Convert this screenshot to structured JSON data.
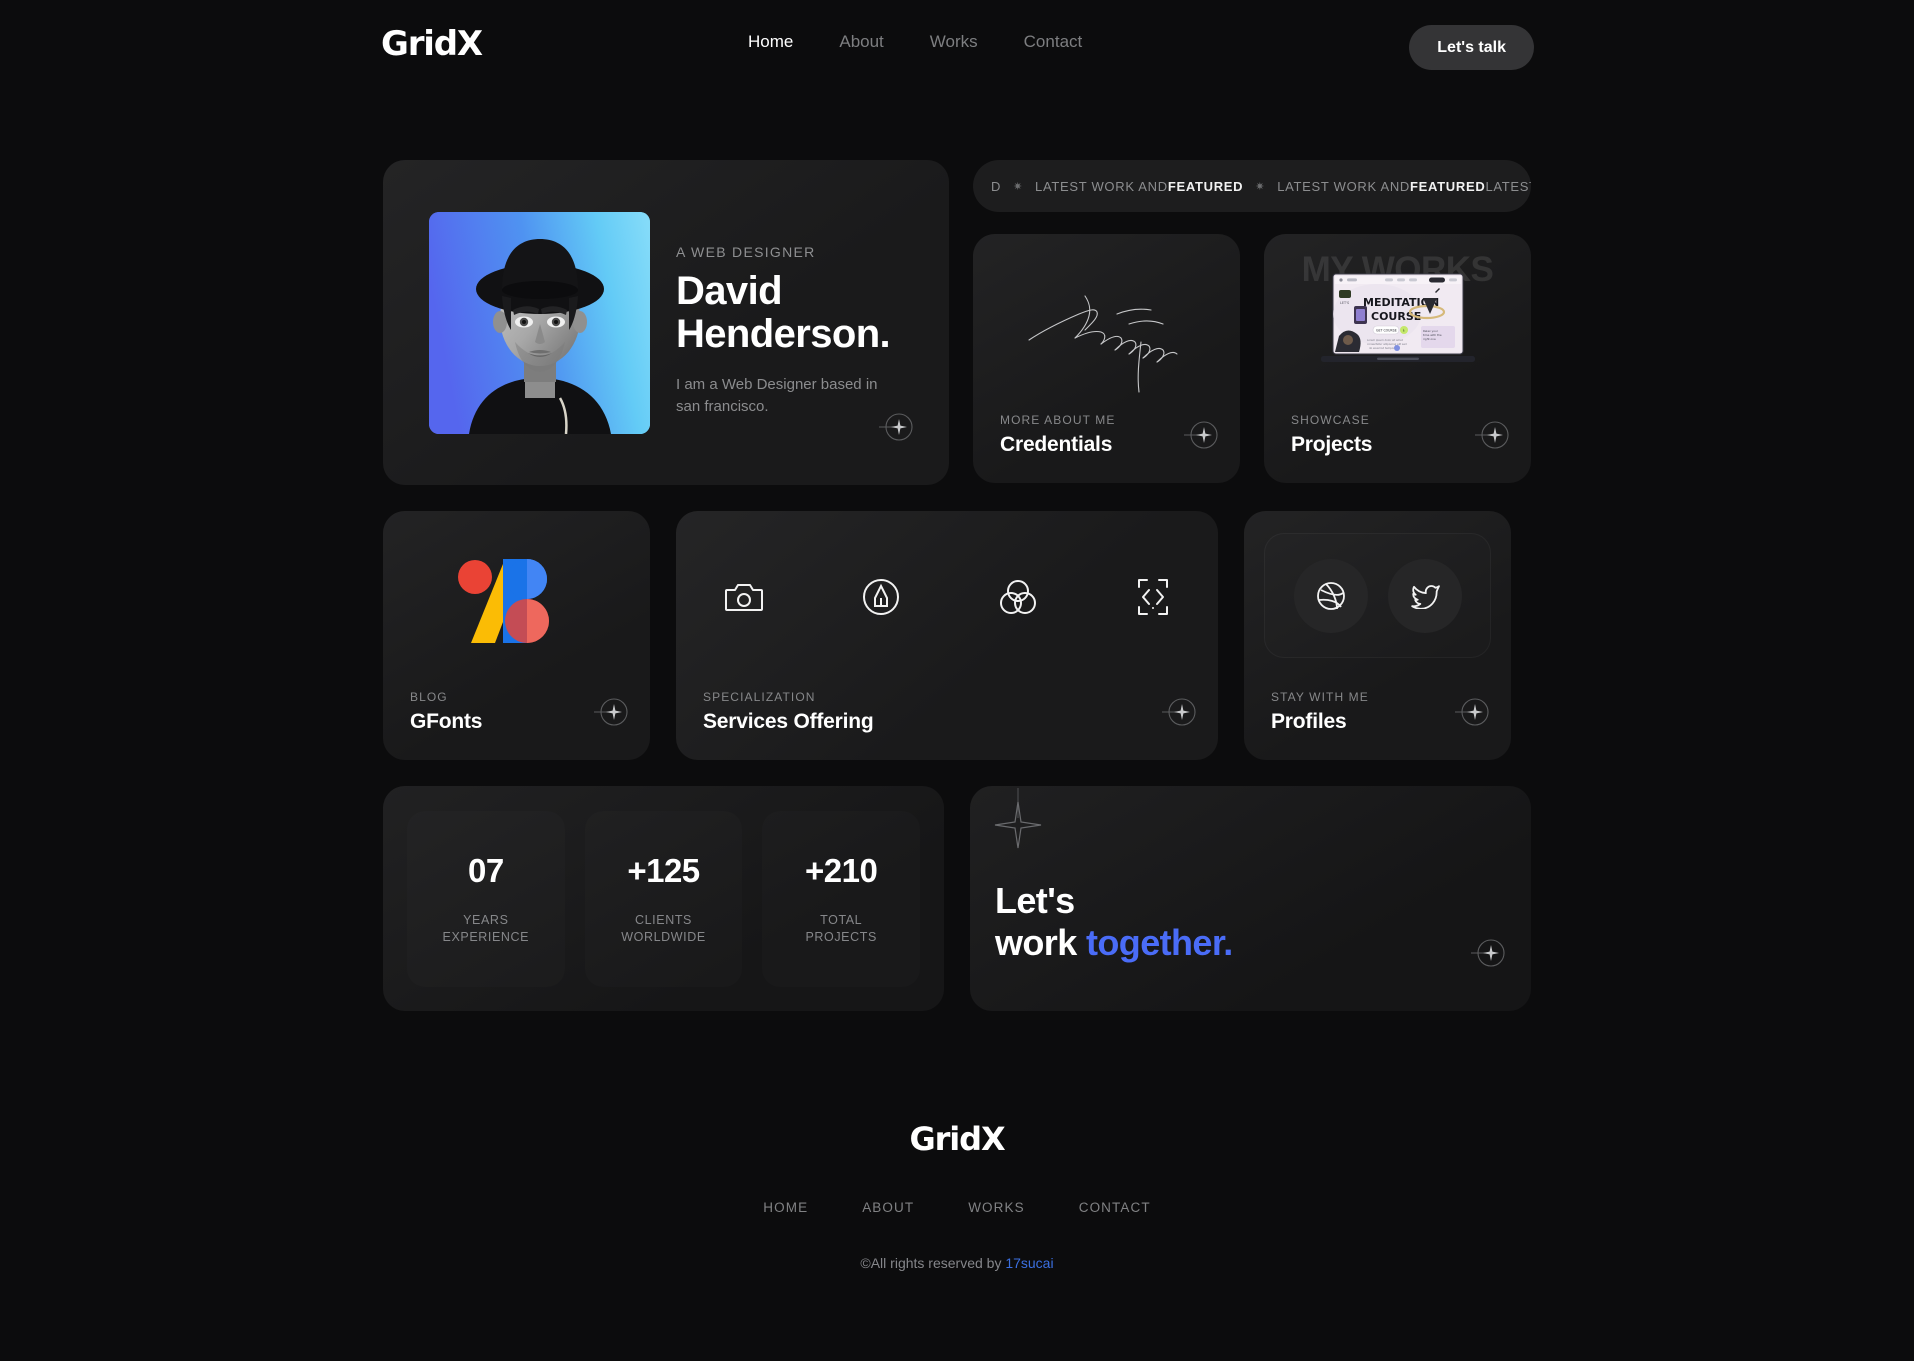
{
  "header": {
    "logo": "GridX",
    "nav": [
      {
        "label": "Home",
        "active": true
      },
      {
        "label": "About",
        "active": false
      },
      {
        "label": "Works",
        "active": false
      },
      {
        "label": "Contact",
        "active": false
      }
    ],
    "cta_button": "Let's talk"
  },
  "hero": {
    "kicker": "A WEB DESIGNER",
    "name_line1": "David",
    "name_line2": "Henderson.",
    "description": "I am a Web Designer based in san francisco.",
    "photo_alt": "portrait-of-david-henderson"
  },
  "marquee": {
    "segment_plain": "LATEST WORK AND ",
    "segment_bold": "FEATURED",
    "lead_fragment": "D",
    "dot": "✷",
    "tail": "LATEST WORK AND"
  },
  "cards": {
    "credentials": {
      "label": "MORE ABOUT ME",
      "title": "Credentials",
      "art": "signature"
    },
    "projects": {
      "label": "SHOWCASE",
      "title": "Projects",
      "watermark": "MY WORKS",
      "art": "laptop-meditation-course",
      "art_title_line1": "MEDITATION",
      "art_title_line2": "COURSE"
    },
    "gfonts": {
      "label": "BLOG",
      "title": "GFonts",
      "art": "google-fonts-shapes"
    },
    "services": {
      "label": "SPECIALIZATION",
      "title": "Services Offering",
      "icons": [
        "camera-icon",
        "pen-circle-icon",
        "color-circles-icon",
        "code-brackets-icon"
      ]
    },
    "profiles": {
      "label": "STAY WITH ME",
      "title": "Profiles",
      "socials": [
        "dribbble-icon",
        "twitter-icon"
      ]
    }
  },
  "stats": [
    {
      "value": "07",
      "label_line1": "YEARS",
      "label_line2": "EXPERIENCE"
    },
    {
      "value": "+125",
      "label_line1": "CLIENTS",
      "label_line2": "WORLDWIDE"
    },
    {
      "value": "+210",
      "label_line1": "TOTAL",
      "label_line2": "PROJECTS"
    }
  ],
  "cta": {
    "line1": "Let's",
    "line2_white": "work ",
    "line2_accent": "together.",
    "accent_color": "#4a6cf7"
  },
  "footer": {
    "logo": "GridX",
    "nav": [
      "HOME",
      "ABOUT",
      "WORKS",
      "CONTACT"
    ],
    "copyright_text": "©All rights reserved by ",
    "copyright_link": "17sucai"
  },
  "colors": {
    "background": "#0c0c0d",
    "card": "#1b1b1c",
    "accent_blue": "#4a6cf7",
    "muted_text": "#86878a"
  }
}
